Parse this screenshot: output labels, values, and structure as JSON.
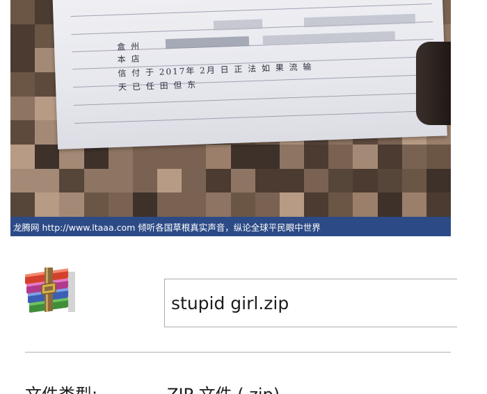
{
  "photo": {
    "handwriting": {
      "line1": "盒 州",
      "line2": "本 店",
      "line3": "信   付 于 2017年 2月 日 正 法 如 果 流 输",
      "line4": "天 已 任 田 但 东"
    },
    "caption": "龙腾网 http://www.ltaaa.com 倾听各国草根真实声音，纵论全球平民眼中世界"
  },
  "file": {
    "icon": "winrar-archive-icon",
    "name": "stupid girl.zip",
    "type_label": "文件类型:",
    "type_value": "ZIP 文件 (.zip)"
  },
  "colors": {
    "caption_bg": "#2c4a86",
    "caption_text": "#ffffff",
    "paper": "#e9eaf0"
  }
}
